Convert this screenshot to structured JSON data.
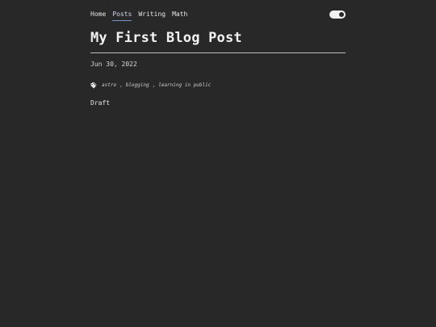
{
  "nav": {
    "items": [
      {
        "label": "Home",
        "active": false
      },
      {
        "label": "Posts",
        "active": true
      },
      {
        "label": "Writing",
        "active": false
      },
      {
        "label": "Math",
        "active": false
      }
    ]
  },
  "theme_toggle": {
    "state": "on",
    "icon": "toggle-switch-icon"
  },
  "post": {
    "title": "My First Blog Post",
    "date": "Jun 30, 2022",
    "tags_icon": "tags-icon",
    "tags": [
      "astro",
      "blogging",
      "learning in public"
    ],
    "status": "Draft"
  },
  "colors": {
    "background": "#282828",
    "text": "#e8e8e8",
    "active_underline": "#7b93c9"
  }
}
